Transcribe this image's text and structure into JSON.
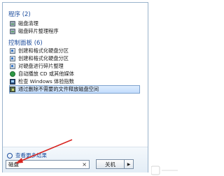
{
  "sections": {
    "programs": {
      "header": "程序 (2)",
      "items": [
        {
          "label": "磁盘清理",
          "icon": "disk-icon"
        },
        {
          "label": "磁盘碎片整理程序",
          "icon": "disk-icon"
        }
      ]
    },
    "control_panel": {
      "header": "控制面板 (6)",
      "items": [
        {
          "label": "创建和格式化硬盘分区",
          "icon": "control-panel-icon"
        },
        {
          "label": "创建和格式化硬盘分区",
          "icon": "control-panel-icon"
        },
        {
          "label": "对硬盘进行碎片整理",
          "icon": "control-panel-icon"
        },
        {
          "label": "自动播放 CD 或其他媒体",
          "icon": "autoplay-icon"
        },
        {
          "label": "检查 Windows 体验指数",
          "icon": "monitor-icon"
        },
        {
          "label": "通过删除不需要的文件释放磁盘空间",
          "icon": "disk-cleanup-icon",
          "selected": true
        }
      ]
    }
  },
  "see_more": "查看更多结果",
  "search": {
    "value": "磁盘",
    "clear": "×"
  },
  "shutdown": {
    "label": "关机",
    "arrow": "▶"
  },
  "colors": {
    "accent": "#1e4e9e",
    "arrow": "#d8231f",
    "selection": "#c2dcfd"
  }
}
